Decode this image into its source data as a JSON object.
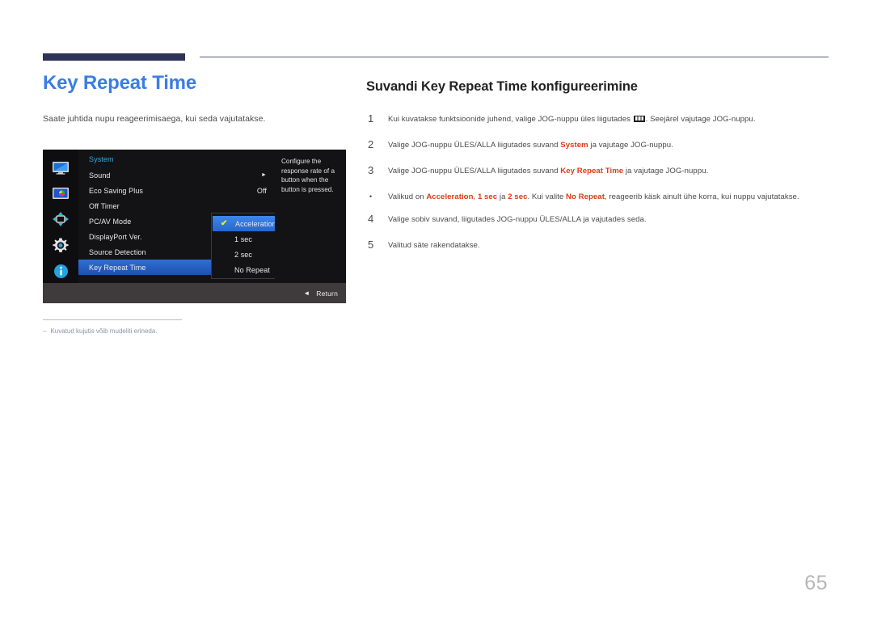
{
  "page": {
    "title": "Key Repeat Time",
    "intro": "Saate juhtida nupu reageerimisaega, kui seda vajutatakse.",
    "number": "65",
    "accent_blue": "#3b7de3",
    "accent_red": "#e03a13",
    "rule_navy": "#2e3357"
  },
  "footnote": {
    "dash": "–",
    "text": "Kuvatud kujutis võib mudeliti erineda."
  },
  "osd": {
    "menu_title": "System",
    "icons": [
      {
        "name": "monitor-icon"
      },
      {
        "name": "picture-icon"
      },
      {
        "name": "move-arrows-icon"
      },
      {
        "name": "gear-icon"
      },
      {
        "name": "info-icon"
      }
    ],
    "rows": [
      {
        "label": "Sound",
        "value": "",
        "arrow": "►",
        "selected": false
      },
      {
        "label": "Eco Saving Plus",
        "value": "Off",
        "arrow": "",
        "selected": false
      },
      {
        "label": "Off Timer",
        "value": "",
        "arrow": "",
        "selected": false
      },
      {
        "label": "PC/AV Mode",
        "value": "",
        "arrow": "",
        "selected": false
      },
      {
        "label": "DisplayPort Ver.",
        "value": "",
        "arrow": "",
        "selected": false
      },
      {
        "label": "Source Detection",
        "value": "",
        "arrow": "",
        "selected": false
      },
      {
        "label": "Key Repeat Time",
        "value": "",
        "arrow": "",
        "selected": true
      }
    ],
    "submenu": [
      {
        "label": "Acceleration",
        "checked": true
      },
      {
        "label": "1 sec",
        "checked": false
      },
      {
        "label": "2 sec",
        "checked": false
      },
      {
        "label": "No Repeat",
        "checked": false
      }
    ],
    "check_mark": "✔",
    "description": "Configure the response rate of a button when the button is pressed.",
    "footer": {
      "icon": "◄",
      "label": "Return"
    }
  },
  "instructions": {
    "title": "Suvandi Key Repeat Time konfigureerimine",
    "steps": [
      {
        "marker": "1",
        "type": "number",
        "parts": [
          {
            "t": "Kui kuvatakse funktsioonide juhend, valige JOG-nuppu üles liigutades ",
            "hl": false
          },
          {
            "t": "",
            "hl": false,
            "glyph": "menu-grid-icon"
          },
          {
            "t": ". Seejärel vajutage JOG-nuppu.",
            "hl": false
          }
        ]
      },
      {
        "marker": "2",
        "type": "number",
        "parts": [
          {
            "t": "Valige JOG-nuppu ÜLES/ALLA liigutades suvand ",
            "hl": false
          },
          {
            "t": "System",
            "hl": true
          },
          {
            "t": " ja vajutage JOG-nuppu.",
            "hl": false
          }
        ]
      },
      {
        "marker": "3",
        "type": "number",
        "parts": [
          {
            "t": "Valige JOG-nuppu ÜLES/ALLA liigutades suvand ",
            "hl": false
          },
          {
            "t": "Key Repeat Time",
            "hl": true
          },
          {
            "t": " ja vajutage JOG-nuppu.",
            "hl": false
          }
        ]
      },
      {
        "marker": "•",
        "type": "bullet",
        "parts": [
          {
            "t": "Valikud on ",
            "hl": false
          },
          {
            "t": "Acceleration",
            "hl": true
          },
          {
            "t": ", ",
            "hl": false
          },
          {
            "t": "1 sec",
            "hl": true
          },
          {
            "t": " ja ",
            "hl": false
          },
          {
            "t": "2 sec",
            "hl": true
          },
          {
            "t": ". Kui valite ",
            "hl": false
          },
          {
            "t": "No Repeat",
            "hl": true
          },
          {
            "t": ", reageerib käsk ainult ühe korra, kui nuppu vajutatakse.",
            "hl": false
          }
        ]
      },
      {
        "marker": "4",
        "type": "number",
        "parts": [
          {
            "t": "Valige sobiv suvand, liigutades JOG-nuppu ÜLES/ALLA ja vajutades seda.",
            "hl": false
          }
        ]
      },
      {
        "marker": "5",
        "type": "number",
        "parts": [
          {
            "t": "Valitud säte rakendatakse.",
            "hl": false
          }
        ]
      }
    ]
  }
}
